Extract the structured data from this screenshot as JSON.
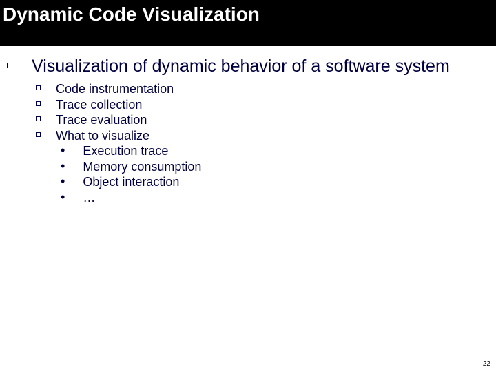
{
  "title": "Dynamic Code Visualization",
  "main_point": "Visualization of dynamic behavior of a software system",
  "sub_points": [
    "Code instrumentation",
    "Trace collection",
    "Trace evaluation",
    "What to visualize"
  ],
  "detail_points": [
    "Execution trace",
    "Memory consumption",
    "Object interaction",
    "…"
  ],
  "page_number": "22"
}
